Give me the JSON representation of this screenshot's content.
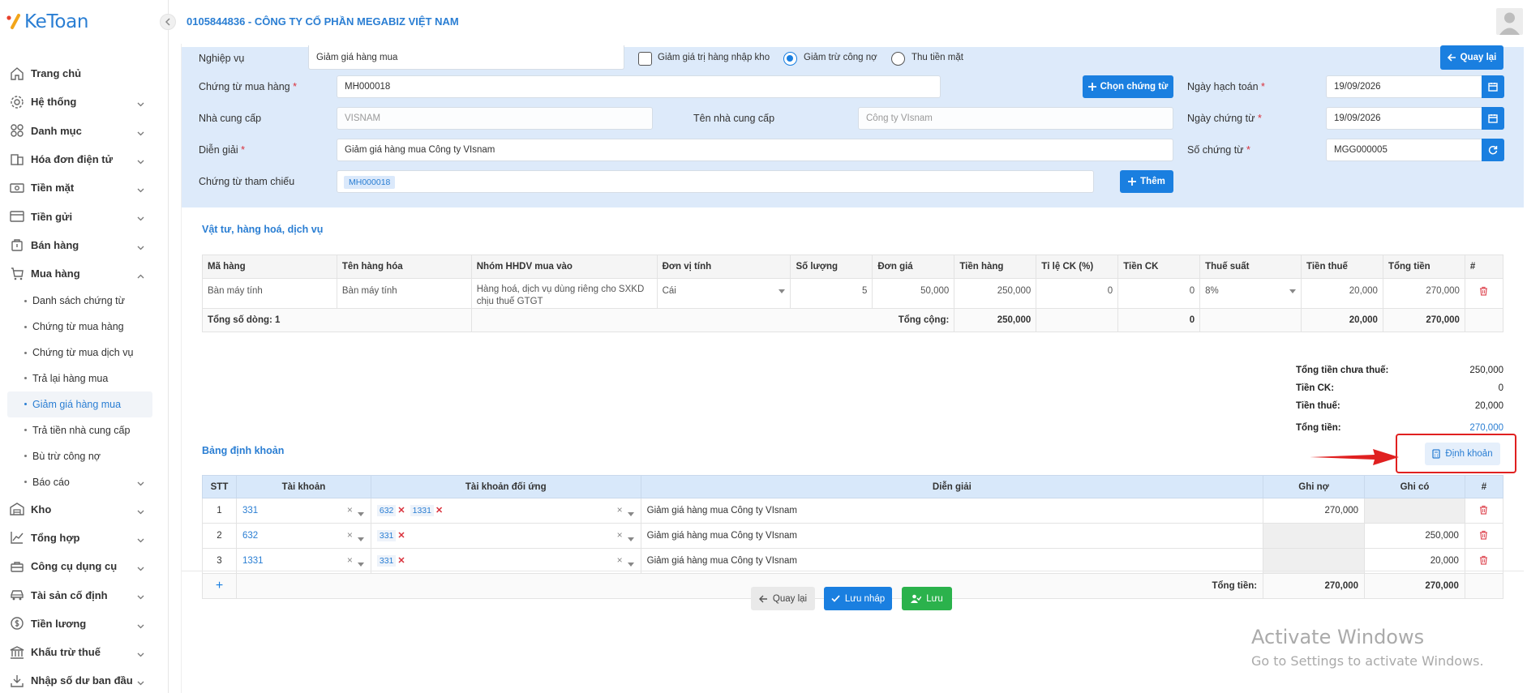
{
  "app": {
    "logo_text": "KeToan",
    "company": "0105844836 - CÔNG TY CỔ PHẦN MEGABIZ VIỆT NAM"
  },
  "sidebar": {
    "items": [
      {
        "label": "Trang chủ",
        "icon": "home-icon"
      },
      {
        "label": "Hệ thống",
        "icon": "gear-icon"
      },
      {
        "label": "Danh mục",
        "icon": "grid-icon"
      },
      {
        "label": "Hóa đơn điện tử",
        "icon": "invoice-icon"
      },
      {
        "label": "Tiền mặt",
        "icon": "cash-icon"
      },
      {
        "label": "Tiền gửi",
        "icon": "card-icon"
      },
      {
        "label": "Bán hàng",
        "icon": "bag-icon"
      },
      {
        "label": "Mua hàng",
        "icon": "cart-icon"
      }
    ],
    "sub_items": [
      {
        "label": "Danh sách chứng từ"
      },
      {
        "label": "Chứng từ mua hàng"
      },
      {
        "label": "Chứng từ mua dịch vụ"
      },
      {
        "label": "Trả lại hàng mua"
      },
      {
        "label": "Giảm giá hàng mua"
      },
      {
        "label": "Trả tiền nhà cung cấp"
      },
      {
        "label": "Bù trừ công nợ"
      },
      {
        "label": "Báo cáo"
      }
    ],
    "items2": [
      {
        "label": "Kho",
        "icon": "warehouse-icon"
      },
      {
        "label": "Tổng hợp",
        "icon": "chart-icon"
      },
      {
        "label": "Công cụ dụng cụ",
        "icon": "tools-icon"
      },
      {
        "label": "Tài sản cố định",
        "icon": "car-icon"
      },
      {
        "label": "Tiền lương",
        "icon": "salary-icon"
      },
      {
        "label": "Khấu trừ thuế",
        "icon": "bank-icon"
      },
      {
        "label": "Nhập số dư ban đầu",
        "icon": "download-icon"
      }
    ]
  },
  "form": {
    "nghiep_vu_label": "Nghiệp vụ",
    "nghiep_vu_value": "Giảm giá hàng mua",
    "opt_giam_gia_kho": "Giảm giá trị hàng nhập kho",
    "opt_giam_tru": "Giảm trừ công nợ",
    "opt_thu_tien": "Thu tiền mặt",
    "back_label": "Quay lại",
    "chung_tu_mua_label": "Chứng từ mua hàng",
    "chung_tu_mua_value": "MH000018",
    "chon_chung_tu_label": "Chọn chứng từ",
    "ngay_hach_toan_label": "Ngày hạch toán",
    "ngay_hach_toan_value": "19/09/2026",
    "ncc_label": "Nhà cung cấp",
    "ncc_value": "VISNAM",
    "ten_ncc_label": "Tên nhà cung cấp",
    "ten_ncc_value": "Công ty VIsnam",
    "ngay_chung_tu_label": "Ngày chứng từ",
    "ngay_chung_tu_value": "19/09/2026",
    "dien_giai_label": "Diễn giải",
    "dien_giai_value": "Giảm giá hàng mua Công ty VIsnam",
    "so_chung_tu_label": "Số chứng từ",
    "so_chung_tu_value": "MGG000005",
    "tham_chieu_label": "Chứng từ tham chiếu",
    "tham_chieu_tag": "MH000018",
    "them_label": "Thêm",
    "required_mark": "*"
  },
  "goods": {
    "title": "Vật tư, hàng hoá, dịch vụ",
    "headers": [
      "Mã hàng",
      "Tên hàng hóa",
      "Nhóm HHDV mua vào",
      "Đơn vị tính",
      "Số lượng",
      "Đơn giá",
      "Tiền hàng",
      "Tỉ lệ CK (%)",
      "Tiền CK",
      "Thuế suất",
      "Tiền thuế",
      "Tổng tiền",
      "#"
    ],
    "rows": [
      {
        "ma": "Bàn máy tính",
        "ten": "Bàn máy tính",
        "nhom": "Hàng hoá, dịch vụ dùng riêng cho SXKD chịu thuế GTGT",
        "dvt": "Cái",
        "sl": "5",
        "dg": "50,000",
        "tien_hang": "250,000",
        "ck_pct": "0",
        "tien_ck": "0",
        "thue_suat": "8%",
        "tien_thue": "20,000",
        "tong": "270,000"
      }
    ],
    "total_rows_label": "Tổng số dòng: 1",
    "total_label": "Tổng cộng:",
    "total_tien_hang": "250,000",
    "total_ck": "0",
    "total_thue": "20,000",
    "total_tong": "270,000"
  },
  "summary": {
    "chua_thue_label": "Tổng tiền chưa thuế:",
    "chua_thue": "250,000",
    "ck_label": "Tiền CK:",
    "ck": "0",
    "thue_label": "Tiền thuế:",
    "thue": "20,000",
    "tong_label": "Tổng tiền:",
    "tong": "270,000"
  },
  "gl": {
    "title": "Bảng định khoản",
    "dinh_khoan_btn": "Định khoản",
    "headers": [
      "STT",
      "Tài khoản",
      "Tài khoản đối ứng",
      "Diễn giải",
      "Ghi nợ",
      "Ghi có",
      "#"
    ],
    "rows": [
      {
        "stt": "1",
        "tk": "331",
        "du": [
          "632",
          "1331"
        ],
        "dg": "Giảm giá hàng mua Công ty VIsnam",
        "no": "270,000",
        "co": ""
      },
      {
        "stt": "2",
        "tk": "632",
        "du": [
          "331"
        ],
        "dg": "Giảm giá hàng mua Công ty VIsnam",
        "no": "",
        "co": "250,000"
      },
      {
        "stt": "3",
        "tk": "1331",
        "du": [
          "331"
        ],
        "dg": "Giảm giá hàng mua Công ty VIsnam",
        "no": "",
        "co": "20,000"
      }
    ],
    "add": "+",
    "total_label": "Tổng tiền:",
    "total_no": "270,000",
    "total_co": "270,000"
  },
  "footer": {
    "back": "Quay lại",
    "save_draft": "Lưu nháp",
    "save": "Lưu"
  },
  "watermark": {
    "line1": "Activate Windows",
    "line2": "Go to Settings to activate Windows."
  },
  "colors": {
    "accent": "#1a7fe0",
    "panel": "#ddeafa",
    "save_green": "#2bb24c",
    "highlight_red": "#e02020"
  }
}
